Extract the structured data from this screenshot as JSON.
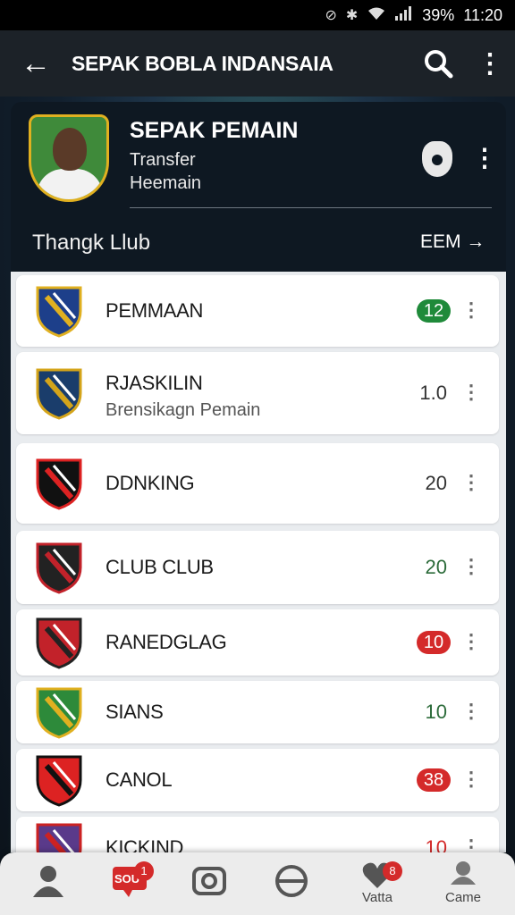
{
  "status_bar": {
    "battery": "39%",
    "time": "11:20",
    "icons": [
      "mute-icon",
      "bluetooth-icon",
      "wifi-icon",
      "signal-icon"
    ]
  },
  "app_bar": {
    "title": "SEPAK BOBLA INDANSAIA",
    "back_icon": "arrow-left-icon",
    "search_icon": "search-icon",
    "menu_icon": "more-vertical-icon"
  },
  "profile": {
    "name": "SEPAK PEMAIN",
    "subtitle_1": "Transfer",
    "subtitle_2": "Heemain",
    "club_label": "Thangk Llub",
    "club_link": "EEM →"
  },
  "clubs": [
    {
      "name": "PEMMAAN",
      "sub": "",
      "value": "12",
      "style": "pill",
      "color": "#1f8a3a"
    },
    {
      "name": "RJASKILIN",
      "sub": "Brensikagn Pemain",
      "value": "1.0",
      "style": "plain",
      "color": "#333333"
    },
    {
      "name": "DDNKING",
      "sub": "",
      "value": "20",
      "style": "plain",
      "color": "#333333"
    },
    {
      "name": "CLUB CLUB",
      "sub": "",
      "value": "20",
      "style": "plain",
      "color": "#2c6b3a"
    },
    {
      "name": "RANEDGLAG",
      "sub": "",
      "value": "10",
      "style": "pill",
      "color": "#d42a2a"
    },
    {
      "name": "SIANS",
      "sub": "",
      "value": "10",
      "style": "plain",
      "color": "#2c6b3a"
    },
    {
      "name": "CANOL",
      "sub": "",
      "value": "38",
      "style": "pill",
      "color": "#d42a2a"
    },
    {
      "name": "KICKIND",
      "sub": "",
      "value": "10",
      "style": "plain",
      "color": "#d42a2a"
    }
  ],
  "bottom_nav": [
    {
      "icon": "person-icon",
      "label": "",
      "badge": ""
    },
    {
      "icon": "chat-icon",
      "label": "",
      "badge": "1",
      "inner": "SOU"
    },
    {
      "icon": "camera-icon",
      "label": "",
      "badge": ""
    },
    {
      "icon": "ball-icon",
      "label": "",
      "badge": ""
    },
    {
      "icon": "heart-icon",
      "label": "Vatta",
      "badge": "8"
    },
    {
      "icon": "user-icon",
      "label": "Came",
      "badge": ""
    }
  ]
}
